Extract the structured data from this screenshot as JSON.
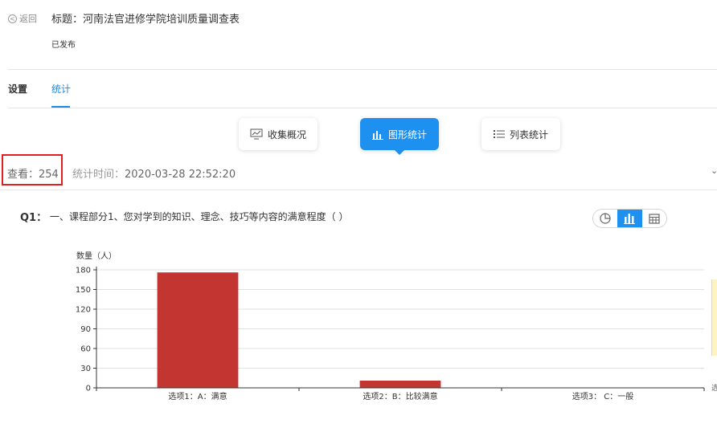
{
  "header": {
    "back_label": "返回",
    "title": "标题：河南法官进修学院培训质量调查表",
    "status": "已发布"
  },
  "tabs": [
    {
      "label": "设置"
    },
    {
      "label": "统计"
    }
  ],
  "view_buttons": [
    {
      "label": "收集概况"
    },
    {
      "label": "图形统计"
    },
    {
      "label": "列表统计"
    }
  ],
  "stats": {
    "views_label": "查看：",
    "views_value": "254",
    "time_label": "统计时间：",
    "time_value": "2020-03-28 22:52:20"
  },
  "question": {
    "number": "Q1：",
    "text": "一、课程部分1、您对学到的知识、理念、技巧等内容的满意程度（    ）"
  },
  "colors": {
    "accent": "#1e90f0",
    "bar": "#c23531",
    "highlight_border": "#e02020"
  },
  "chart_data": {
    "type": "bar",
    "ylabel": "数量（人）",
    "xlabel": "",
    "categories": [
      "选项1：A：满意",
      "选项2：B：比较满意",
      "选项3： C：一般"
    ],
    "values": [
      176,
      11,
      0
    ],
    "ylim": [
      0,
      180
    ],
    "yticks": [
      0,
      30,
      60,
      90,
      120,
      150,
      180
    ],
    "grid": true
  }
}
